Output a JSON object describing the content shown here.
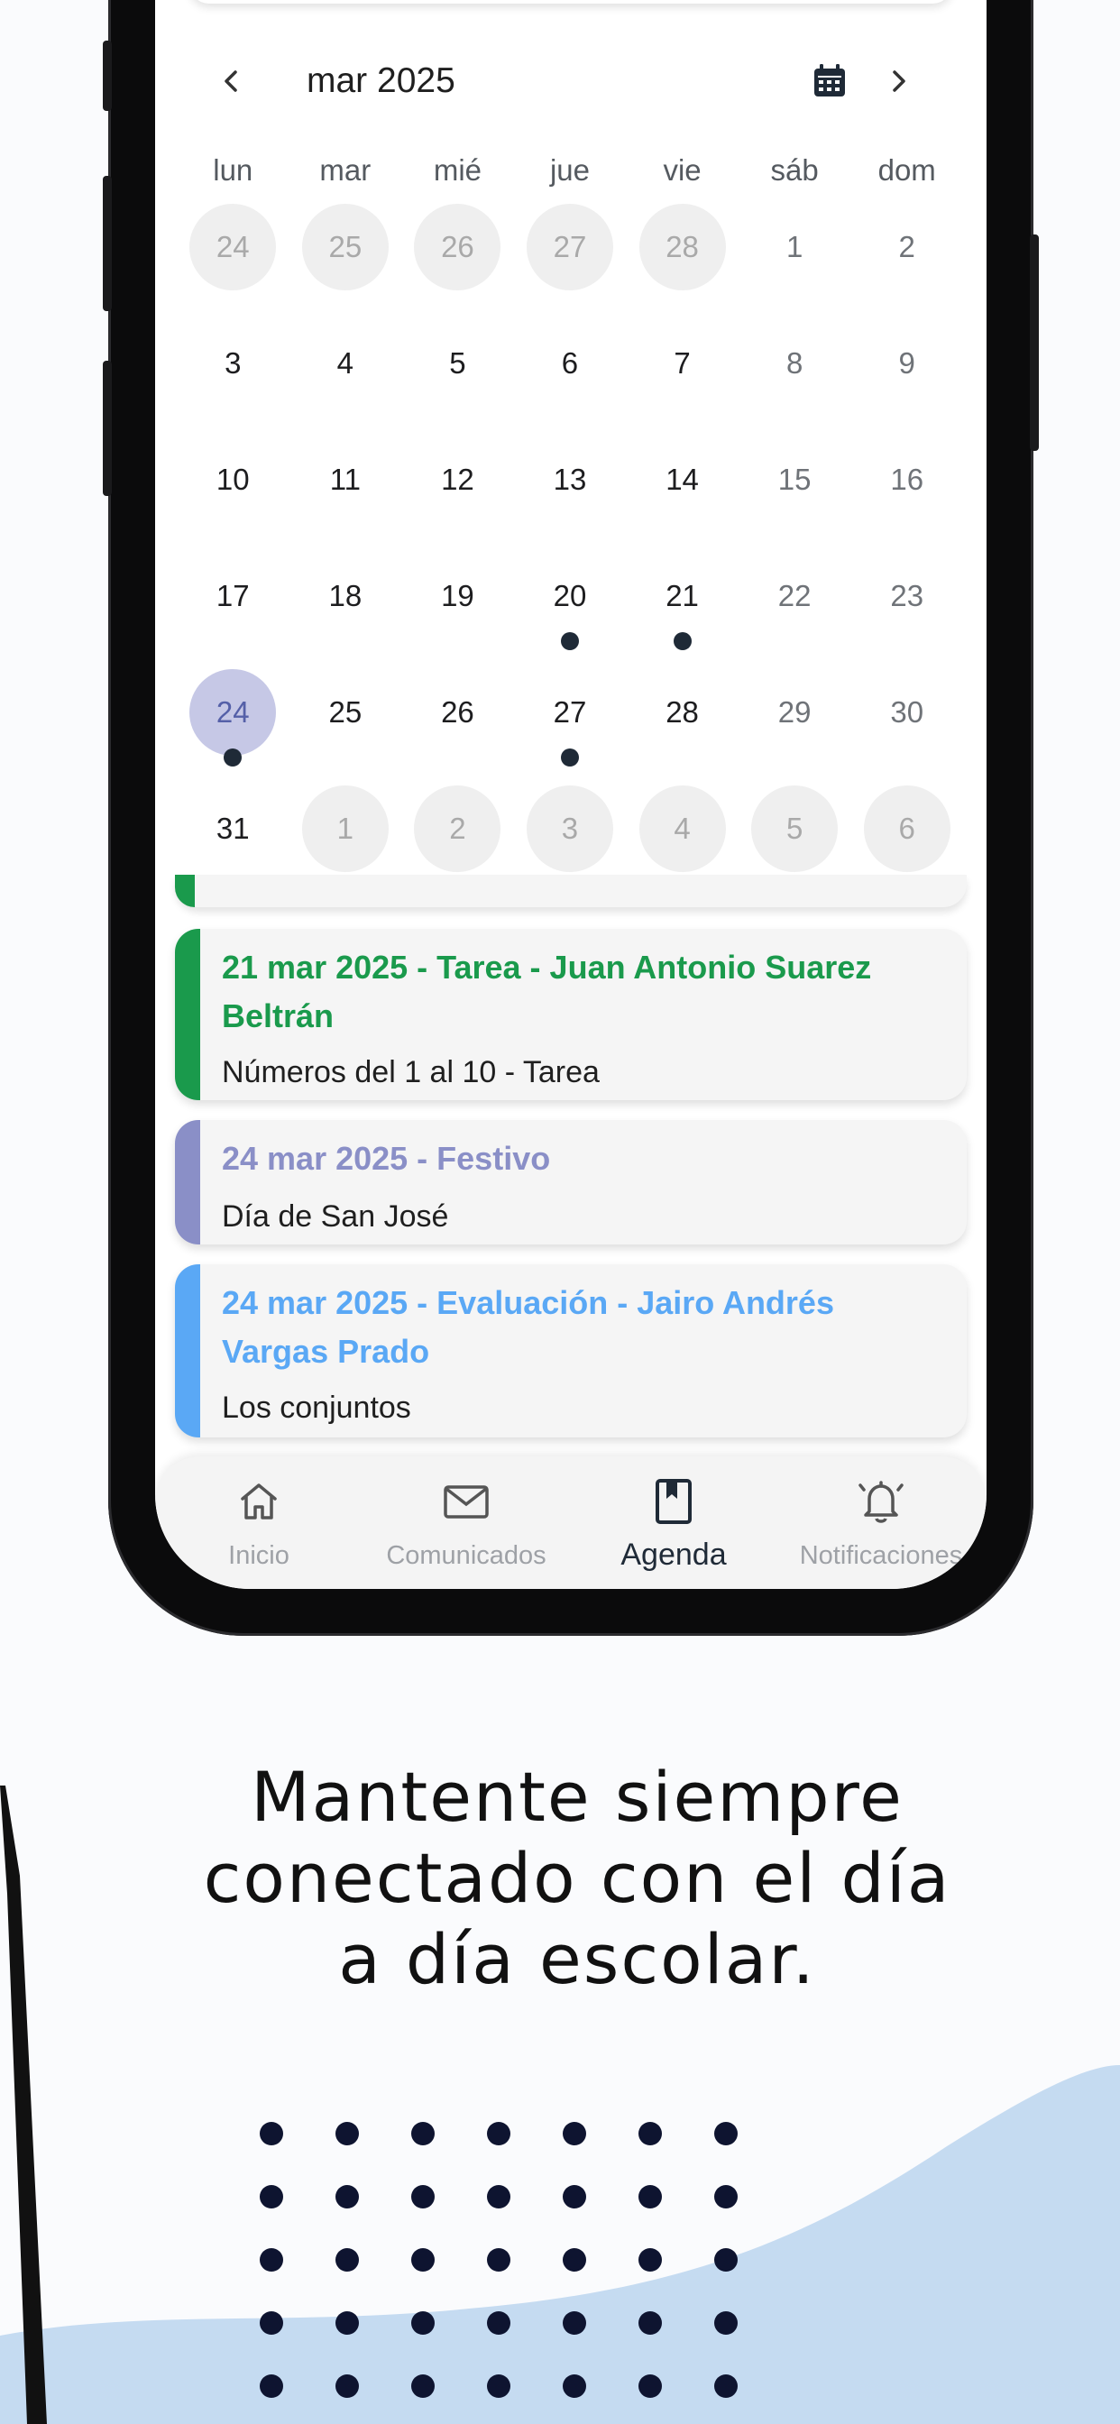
{
  "calendar": {
    "month_label": "mar 2025",
    "weekdays": [
      "lun",
      "mar",
      "mié",
      "jue",
      "vie",
      "sáb",
      "dom"
    ],
    "days": [
      {
        "n": "24",
        "other": true,
        "weekend": false
      },
      {
        "n": "25",
        "other": true,
        "weekend": false
      },
      {
        "n": "26",
        "other": true,
        "weekend": false
      },
      {
        "n": "27",
        "other": true,
        "weekend": false
      },
      {
        "n": "28",
        "other": true,
        "weekend": false
      },
      {
        "n": "1",
        "other": false,
        "weekend": true
      },
      {
        "n": "2",
        "other": false,
        "weekend": true
      },
      {
        "n": "3",
        "other": false,
        "weekend": false
      },
      {
        "n": "4",
        "other": false,
        "weekend": false
      },
      {
        "n": "5",
        "other": false,
        "weekend": false
      },
      {
        "n": "6",
        "other": false,
        "weekend": false
      },
      {
        "n": "7",
        "other": false,
        "weekend": false
      },
      {
        "n": "8",
        "other": false,
        "weekend": true
      },
      {
        "n": "9",
        "other": false,
        "weekend": true
      },
      {
        "n": "10",
        "other": false,
        "weekend": false
      },
      {
        "n": "11",
        "other": false,
        "weekend": false
      },
      {
        "n": "12",
        "other": false,
        "weekend": false
      },
      {
        "n": "13",
        "other": false,
        "weekend": false
      },
      {
        "n": "14",
        "other": false,
        "weekend": false
      },
      {
        "n": "15",
        "other": false,
        "weekend": true
      },
      {
        "n": "16",
        "other": false,
        "weekend": true
      },
      {
        "n": "17",
        "other": false,
        "weekend": false
      },
      {
        "n": "18",
        "other": false,
        "weekend": false
      },
      {
        "n": "19",
        "other": false,
        "weekend": false
      },
      {
        "n": "20",
        "other": false,
        "weekend": false,
        "event": true
      },
      {
        "n": "21",
        "other": false,
        "weekend": false,
        "event": true
      },
      {
        "n": "22",
        "other": false,
        "weekend": true
      },
      {
        "n": "23",
        "other": false,
        "weekend": true
      },
      {
        "n": "24",
        "other": false,
        "weekend": false,
        "event": true,
        "selected": true
      },
      {
        "n": "25",
        "other": false,
        "weekend": false
      },
      {
        "n": "26",
        "other": false,
        "weekend": false
      },
      {
        "n": "27",
        "other": false,
        "weekend": false,
        "event": true
      },
      {
        "n": "28",
        "other": false,
        "weekend": false
      },
      {
        "n": "29",
        "other": false,
        "weekend": true
      },
      {
        "n": "30",
        "other": false,
        "weekend": true
      },
      {
        "n": "31",
        "other": false,
        "weekend": false
      },
      {
        "n": "1",
        "other": true,
        "weekend": false
      },
      {
        "n": "2",
        "other": true,
        "weekend": false
      },
      {
        "n": "3",
        "other": true,
        "weekend": false
      },
      {
        "n": "4",
        "other": true,
        "weekend": false
      },
      {
        "n": "5",
        "other": true,
        "weekend": false
      },
      {
        "n": "6",
        "other": true,
        "weekend": false
      }
    ]
  },
  "events": [
    {
      "title": "21 mar 2025 - Tarea - Juan Antonio Suarez Beltrán",
      "subtitle": "Números del 1 al 10 - Tarea",
      "color": "#1a9a4c"
    },
    {
      "title": "24 mar 2025 - Festivo",
      "subtitle": "Día de San José",
      "color": "#8a8fc7"
    },
    {
      "title": "24 mar 2025 - Evaluación - Jairo Andrés Vargas Prado",
      "subtitle": "Los conjuntos",
      "color": "#5aa8f5"
    }
  ],
  "nav": {
    "inicio": "Inicio",
    "comunicados": "Comunicados",
    "agenda": "Agenda",
    "notificaciones": "Notificaciones"
  },
  "tagline": {
    "line1": "Mantente siempre",
    "line2": "conectado con el día",
    "line3": "a día escolar."
  },
  "colors": {
    "accent": "#1f2a37",
    "selected_day": "#c6c8e6",
    "background_wave": "#c5dbf1"
  },
  "icons": [
    "chevron-left-icon",
    "calendar-icon",
    "chevron-right-icon",
    "home-icon",
    "mail-icon",
    "bookmark-icon",
    "bell-icon"
  ]
}
